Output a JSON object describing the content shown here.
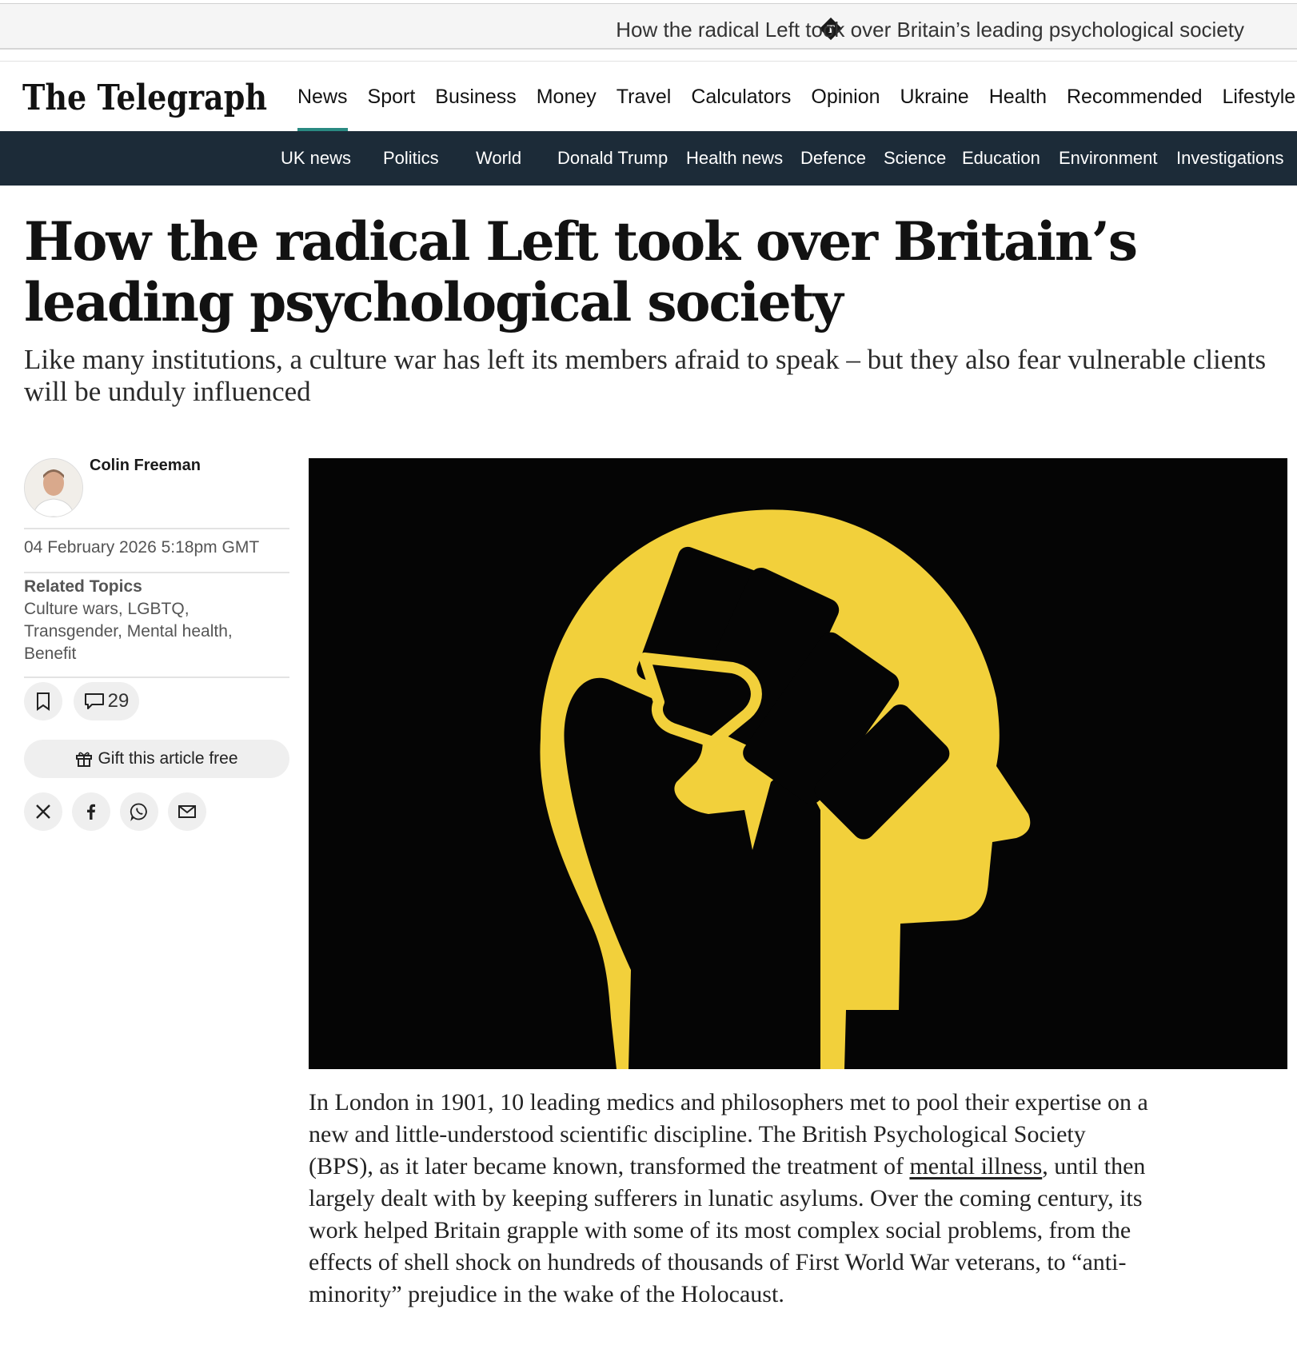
{
  "browser": {
    "tab_title": "How the radical Left took over Britain’s leading psychological society",
    "favicon": "telegraph-favicon-icon"
  },
  "site": {
    "logo_text": "The Telegraph",
    "nav": [
      "News",
      "Sport",
      "Business",
      "Money",
      "Travel",
      "Calculators",
      "Opinion",
      "Ukraine",
      "Health",
      "Recommended",
      "Lifestyle"
    ],
    "nav_active": "News",
    "subnav": [
      "UK news",
      "Politics",
      "World",
      "Donald Trump",
      "Health news",
      "Defence",
      "Science",
      "Education",
      "Environment",
      "Investigations"
    ]
  },
  "article": {
    "headline": "How the radical Left took over Britain’s leading psychological society",
    "standfirst": "Like many institutions, a culture war has left its members afraid to speak – but they also fear vulnerable clients will be unduly influenced",
    "author": "Colin Freeman",
    "date": "04 February 2026 5:18pm GMT",
    "related_topics_heading": "Related Topics",
    "related_topics": "Culture wars, LGBTQ, Transgender, Mental health, Benefit",
    "comments_count": "29",
    "gift_label": "Gift this article free",
    "share_icons": [
      "x-icon",
      "facebook-icon",
      "whatsapp-icon",
      "email-icon"
    ],
    "body_before_link": "In London in 1901, 10 leading medics and philosophers met to pool their expertise on a new and little-understood scientific discipline. The British Psychological Society (BPS), as it later became known, transformed the treatment of ",
    "body_link": "mental illness",
    "body_after_link": ", until then largely dealt with by keeping sufferers in lunatic asylums. Over the coming century, its work helped Britain grapple with some of its most complex social problems, from the effects of shell shock on hundreds of thousands of First World War veterans, to “anti-minority” prejudice in the wake of the Holocaust."
  },
  "colors": {
    "subnav_bg": "#1c2b38",
    "nav_active_underline": "#2a8a82",
    "hero_bg": "#050505",
    "hero_yellow": "#f2d03b"
  }
}
